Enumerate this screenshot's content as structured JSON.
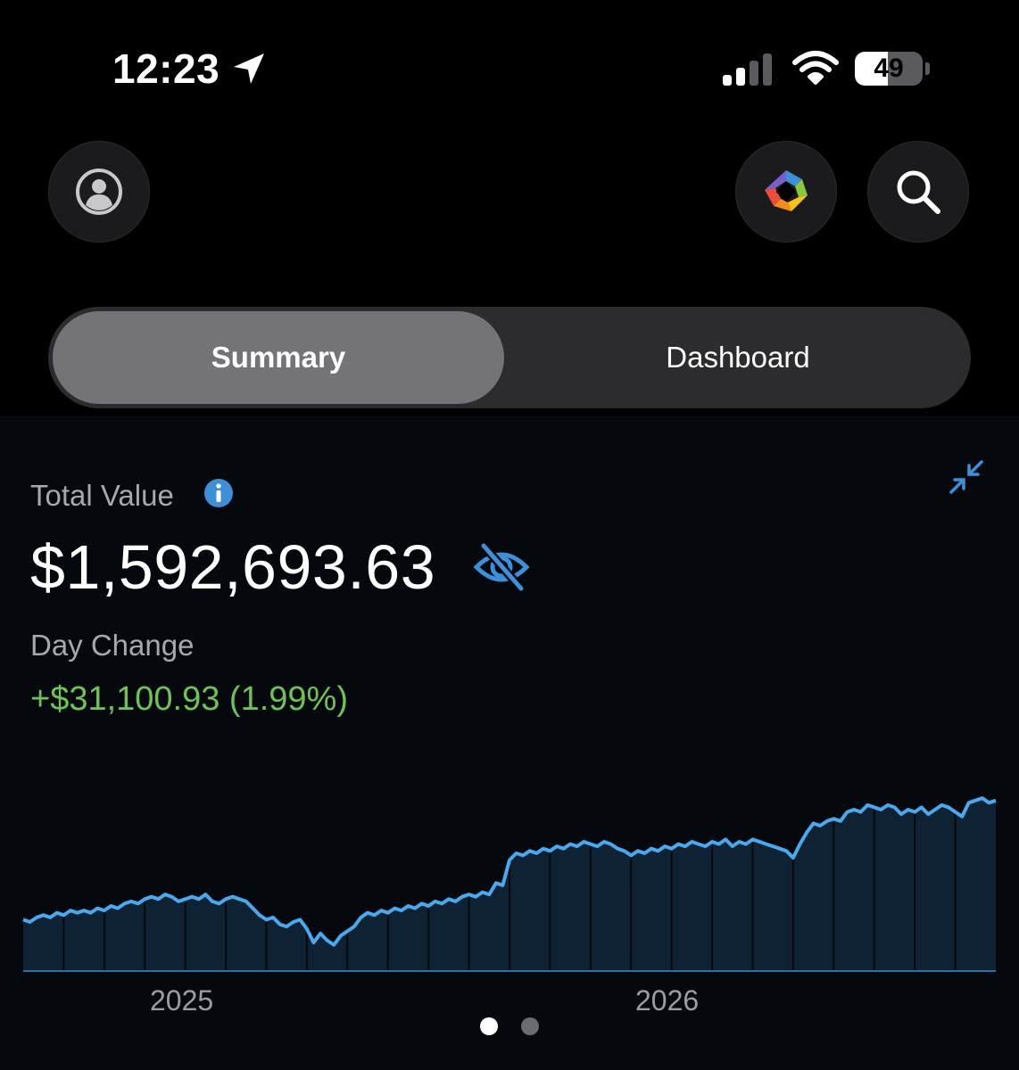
{
  "status_bar": {
    "time": "12:23",
    "battery_level": 49,
    "battery_text": "49",
    "signal_bars_active": 2,
    "signal_bars_total": 4,
    "icons": [
      "location-arrow-icon",
      "signal-icon",
      "wifi-icon",
      "battery-icon"
    ]
  },
  "header": {
    "icons": [
      "profile-icon",
      "app-logo-icon",
      "search-icon"
    ]
  },
  "tabs": [
    {
      "label": "Summary",
      "selected": true
    },
    {
      "label": "Dashboard",
      "selected": false
    }
  ],
  "portfolio": {
    "total_label": "Total Value",
    "total_value": "$1,592,693.63",
    "day_label": "Day Change",
    "day_change": "+$31,100.93 (1.99%)",
    "icons": [
      "info-icon",
      "collapse-icon",
      "eye-off-icon"
    ]
  },
  "colors": {
    "accent_blue": "#4a9fe6",
    "gain_green": "#6fc25a",
    "line_blue": "#4aa8ee",
    "area_fill": "#0f2233"
  },
  "chart_data": {
    "type": "area",
    "x_tick_labels": [
      "2025",
      "2026"
    ],
    "values": [
      100,
      99,
      101,
      102,
      101,
      103,
      102,
      104,
      103,
      104,
      103,
      105,
      104,
      106,
      105,
      107,
      108,
      107,
      109,
      110,
      109,
      111,
      110,
      108,
      109,
      110,
      109,
      111,
      108,
      107,
      109,
      110,
      109,
      108,
      105,
      102,
      100,
      101,
      98,
      97,
      99,
      100,
      96,
      90,
      94,
      91,
      89,
      93,
      95,
      97,
      101,
      103,
      102,
      104,
      103,
      105,
      104,
      106,
      105,
      107,
      106,
      108,
      107,
      109,
      108,
      110,
      111,
      110,
      112,
      111,
      116,
      115,
      126,
      129,
      128,
      130,
      129,
      131,
      130,
      132,
      131,
      133,
      132,
      134,
      133,
      132,
      134,
      133,
      131,
      130,
      128,
      130,
      129,
      131,
      130,
      132,
      131,
      133,
      132,
      134,
      133,
      132,
      134,
      133,
      135,
      132,
      134,
      133,
      135,
      134,
      133,
      132,
      131,
      130,
      127,
      133,
      138,
      142,
      141,
      143,
      144,
      143,
      147,
      148,
      147,
      150,
      149,
      148,
      150,
      149,
      146,
      148,
      147,
      149,
      146,
      148,
      150,
      149,
      147,
      145,
      151,
      152,
      153,
      151,
      152
    ],
    "grid": false
  }
}
